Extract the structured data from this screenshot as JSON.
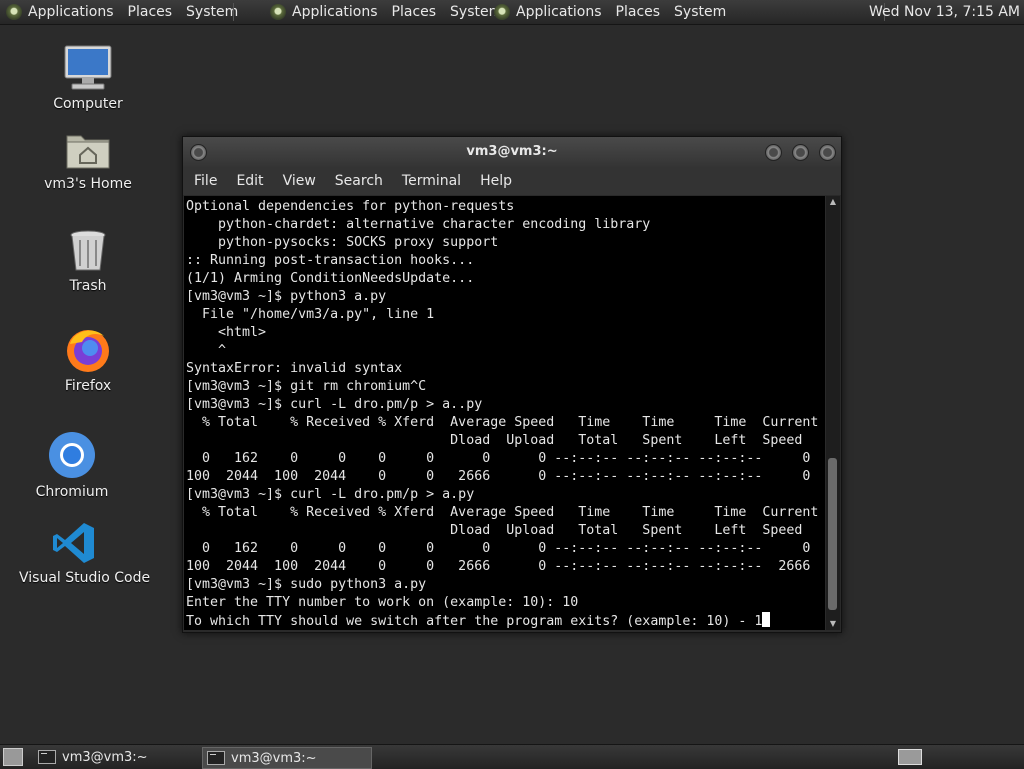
{
  "top_panel": {
    "groups": [
      {
        "applications": "Applications",
        "places": "Places",
        "system": "System"
      },
      {
        "applications": "Applications",
        "places": "Places",
        "system": "System"
      },
      {
        "applications": "Applications",
        "places": "Places",
        "system": "System"
      }
    ],
    "clock": "Wed Nov 13,  7:15 AM"
  },
  "desktop_icons": [
    {
      "label": "Computer",
      "icon": "computer-icon"
    },
    {
      "label": "vm3's Home",
      "icon": "home-folder-icon"
    },
    {
      "label": "Trash",
      "icon": "trash-icon"
    },
    {
      "label": "Firefox",
      "icon": "firefox-icon"
    },
    {
      "label": "Chromium",
      "icon": "chromium-icon"
    },
    {
      "label": "Visual Studio Code",
      "icon": "vscode-icon"
    }
  ],
  "terminal": {
    "title": "vm3@vm3:~",
    "menu": [
      "File",
      "Edit",
      "View",
      "Search",
      "Terminal",
      "Help"
    ],
    "lines": [
      "Optional dependencies for python-requests",
      "    python-chardet: alternative character encoding library",
      "    python-pysocks: SOCKS proxy support",
      ":: Running post-transaction hooks...",
      "(1/1) Arming ConditionNeedsUpdate...",
      "[vm3@vm3 ~]$ python3 a.py",
      "  File \"/home/vm3/a.py\", line 1",
      "    <html>",
      "    ^",
      "SyntaxError: invalid syntax",
      "[vm3@vm3 ~]$ git rm chromium^C",
      "[vm3@vm3 ~]$ curl -L dro.pm/p > a..py",
      "  % Total    % Received % Xferd  Average Speed   Time    Time     Time  Current",
      "                                 Dload  Upload   Total   Spent    Left  Speed",
      "  0   162    0     0    0     0      0      0 --:--:-- --:--:-- --:--:--     0",
      "100  2044  100  2044    0     0   2666      0 --:--:-- --:--:-- --:--:--     0",
      "[vm3@vm3 ~]$ curl -L dro.pm/p > a.py",
      "  % Total    % Received % Xferd  Average Speed   Time    Time     Time  Current",
      "                                 Dload  Upload   Total   Spent    Left  Speed",
      "  0   162    0     0    0     0      0      0 --:--:-- --:--:-- --:--:--     0",
      "100  2044  100  2044    0     0   2666      0 --:--:-- --:--:-- --:--:--  2666",
      "[vm3@vm3 ~]$ sudo python3 a.py",
      "Enter the TTY number to work on (example: 10): 10"
    ],
    "prompt_line": "To which TTY should we switch after the program exits? (example: 10) - 1"
  },
  "taskbar": {
    "tasks": [
      {
        "label": "vm3@vm3:~",
        "active": false
      },
      {
        "label": "vm3@vm3:~",
        "active": true
      }
    ]
  }
}
